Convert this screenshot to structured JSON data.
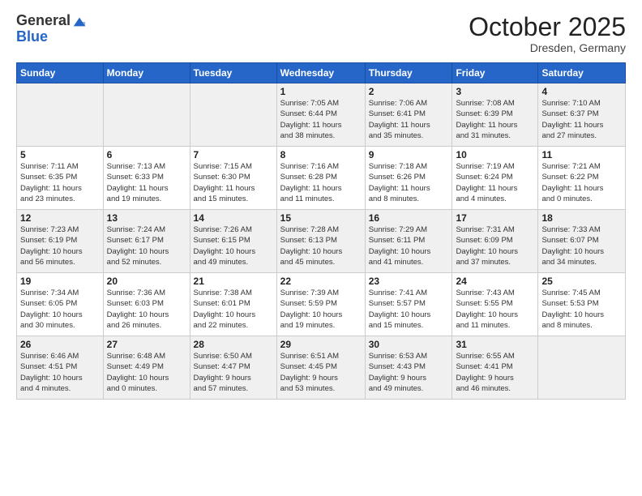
{
  "logo": {
    "general": "General",
    "blue": "Blue"
  },
  "title": "October 2025",
  "location": "Dresden, Germany",
  "days_of_week": [
    "Sunday",
    "Monday",
    "Tuesday",
    "Wednesday",
    "Thursday",
    "Friday",
    "Saturday"
  ],
  "weeks": [
    [
      {
        "day": "",
        "info": ""
      },
      {
        "day": "",
        "info": ""
      },
      {
        "day": "",
        "info": ""
      },
      {
        "day": "1",
        "info": "Sunrise: 7:05 AM\nSunset: 6:44 PM\nDaylight: 11 hours\nand 38 minutes."
      },
      {
        "day": "2",
        "info": "Sunrise: 7:06 AM\nSunset: 6:41 PM\nDaylight: 11 hours\nand 35 minutes."
      },
      {
        "day": "3",
        "info": "Sunrise: 7:08 AM\nSunset: 6:39 PM\nDaylight: 11 hours\nand 31 minutes."
      },
      {
        "day": "4",
        "info": "Sunrise: 7:10 AM\nSunset: 6:37 PM\nDaylight: 11 hours\nand 27 minutes."
      }
    ],
    [
      {
        "day": "5",
        "info": "Sunrise: 7:11 AM\nSunset: 6:35 PM\nDaylight: 11 hours\nand 23 minutes."
      },
      {
        "day": "6",
        "info": "Sunrise: 7:13 AM\nSunset: 6:33 PM\nDaylight: 11 hours\nand 19 minutes."
      },
      {
        "day": "7",
        "info": "Sunrise: 7:15 AM\nSunset: 6:30 PM\nDaylight: 11 hours\nand 15 minutes."
      },
      {
        "day": "8",
        "info": "Sunrise: 7:16 AM\nSunset: 6:28 PM\nDaylight: 11 hours\nand 11 minutes."
      },
      {
        "day": "9",
        "info": "Sunrise: 7:18 AM\nSunset: 6:26 PM\nDaylight: 11 hours\nand 8 minutes."
      },
      {
        "day": "10",
        "info": "Sunrise: 7:19 AM\nSunset: 6:24 PM\nDaylight: 11 hours\nand 4 minutes."
      },
      {
        "day": "11",
        "info": "Sunrise: 7:21 AM\nSunset: 6:22 PM\nDaylight: 11 hours\nand 0 minutes."
      }
    ],
    [
      {
        "day": "12",
        "info": "Sunrise: 7:23 AM\nSunset: 6:19 PM\nDaylight: 10 hours\nand 56 minutes."
      },
      {
        "day": "13",
        "info": "Sunrise: 7:24 AM\nSunset: 6:17 PM\nDaylight: 10 hours\nand 52 minutes."
      },
      {
        "day": "14",
        "info": "Sunrise: 7:26 AM\nSunset: 6:15 PM\nDaylight: 10 hours\nand 49 minutes."
      },
      {
        "day": "15",
        "info": "Sunrise: 7:28 AM\nSunset: 6:13 PM\nDaylight: 10 hours\nand 45 minutes."
      },
      {
        "day": "16",
        "info": "Sunrise: 7:29 AM\nSunset: 6:11 PM\nDaylight: 10 hours\nand 41 minutes."
      },
      {
        "day": "17",
        "info": "Sunrise: 7:31 AM\nSunset: 6:09 PM\nDaylight: 10 hours\nand 37 minutes."
      },
      {
        "day": "18",
        "info": "Sunrise: 7:33 AM\nSunset: 6:07 PM\nDaylight: 10 hours\nand 34 minutes."
      }
    ],
    [
      {
        "day": "19",
        "info": "Sunrise: 7:34 AM\nSunset: 6:05 PM\nDaylight: 10 hours\nand 30 minutes."
      },
      {
        "day": "20",
        "info": "Sunrise: 7:36 AM\nSunset: 6:03 PM\nDaylight: 10 hours\nand 26 minutes."
      },
      {
        "day": "21",
        "info": "Sunrise: 7:38 AM\nSunset: 6:01 PM\nDaylight: 10 hours\nand 22 minutes."
      },
      {
        "day": "22",
        "info": "Sunrise: 7:39 AM\nSunset: 5:59 PM\nDaylight: 10 hours\nand 19 minutes."
      },
      {
        "day": "23",
        "info": "Sunrise: 7:41 AM\nSunset: 5:57 PM\nDaylight: 10 hours\nand 15 minutes."
      },
      {
        "day": "24",
        "info": "Sunrise: 7:43 AM\nSunset: 5:55 PM\nDaylight: 10 hours\nand 11 minutes."
      },
      {
        "day": "25",
        "info": "Sunrise: 7:45 AM\nSunset: 5:53 PM\nDaylight: 10 hours\nand 8 minutes."
      }
    ],
    [
      {
        "day": "26",
        "info": "Sunrise: 6:46 AM\nSunset: 4:51 PM\nDaylight: 10 hours\nand 4 minutes."
      },
      {
        "day": "27",
        "info": "Sunrise: 6:48 AM\nSunset: 4:49 PM\nDaylight: 10 hours\nand 0 minutes."
      },
      {
        "day": "28",
        "info": "Sunrise: 6:50 AM\nSunset: 4:47 PM\nDaylight: 9 hours\nand 57 minutes."
      },
      {
        "day": "29",
        "info": "Sunrise: 6:51 AM\nSunset: 4:45 PM\nDaylight: 9 hours\nand 53 minutes."
      },
      {
        "day": "30",
        "info": "Sunrise: 6:53 AM\nSunset: 4:43 PM\nDaylight: 9 hours\nand 49 minutes."
      },
      {
        "day": "31",
        "info": "Sunrise: 6:55 AM\nSunset: 4:41 PM\nDaylight: 9 hours\nand 46 minutes."
      },
      {
        "day": "",
        "info": ""
      }
    ]
  ]
}
